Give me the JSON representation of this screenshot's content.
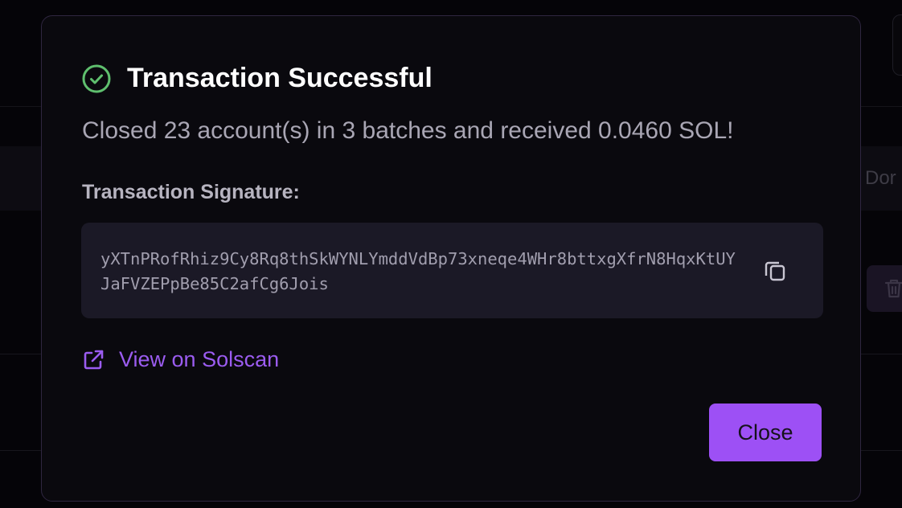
{
  "background": {
    "right_partial_text": "Dor"
  },
  "modal": {
    "title": "Transaction Successful",
    "description": "Closed 23 account(s) in 3 batches and received 0.0460 SOL!",
    "signature_label": "Transaction Signature:",
    "signature": "yXTnPRofRhiz9Cy8Rq8thSkWYNLYmddVdBp73xneqe4WHr8bttxgXfrN8HqxKtUYJaFVZEPpBe85C2afCg6Jois",
    "solscan_link": "View on Solscan",
    "close_label": "Close"
  },
  "icons": {
    "status": "check-circle-icon",
    "copy": "copy-icon",
    "external": "external-link-icon",
    "trash": "trash-icon"
  },
  "colors": {
    "success": "#5fbf6e",
    "accent": "#9d50f5",
    "link": "#9b5cf0"
  }
}
